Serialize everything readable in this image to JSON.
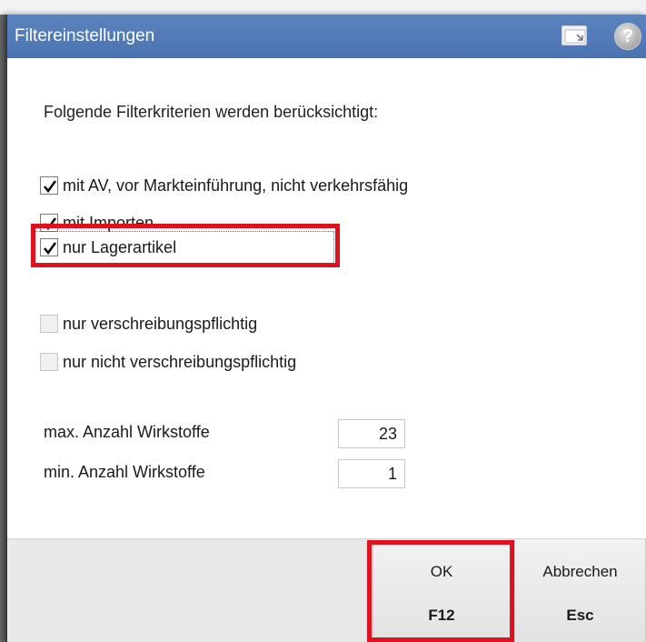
{
  "dialog": {
    "title": "Filtereinstellungen",
    "dock_icon": "dock-window-icon",
    "help_icon": "help-icon",
    "help_glyph": "?"
  },
  "filters": {
    "heading": "Folgende Filterkriterien werden berücksichtigt:",
    "options": [
      {
        "label": "mit AV, vor Markteinführung, nicht verkehrsfähig",
        "checked": true,
        "enabled": true
      },
      {
        "label": "mit Importen",
        "checked": true,
        "enabled": true
      },
      {
        "label": "nur Lagerartikel",
        "checked": true,
        "enabled": true
      },
      {
        "label": "nur verschreibungspflichtig",
        "checked": false,
        "enabled": false
      },
      {
        "label": "nur nicht verschreibungspflichtig",
        "checked": false,
        "enabled": false
      }
    ]
  },
  "fields": {
    "max_label": "max. Anzahl Wirkstoffe",
    "max_value": "23",
    "min_label": "min. Anzahl Wirkstoffe",
    "min_value": "1"
  },
  "buttons": {
    "ok_label": "OK",
    "ok_key": "F12",
    "cancel_label": "Abbrechen",
    "cancel_key": "Esc"
  },
  "colors": {
    "titlebar": "#4a73b1",
    "highlight": "#e0101e",
    "footer": "#e8e8e8"
  }
}
